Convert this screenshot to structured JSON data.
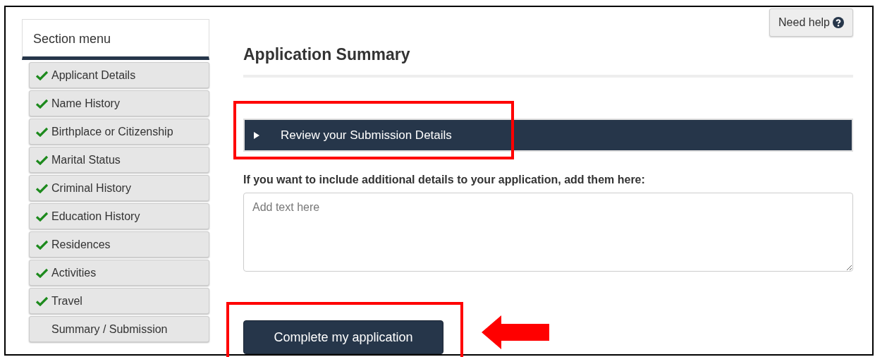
{
  "sidebar": {
    "title": "Section menu",
    "items": [
      {
        "label": "Applicant Details",
        "checked": true
      },
      {
        "label": "Name History",
        "checked": true
      },
      {
        "label": "Birthplace or Citizenship",
        "checked": true
      },
      {
        "label": "Marital Status",
        "checked": true
      },
      {
        "label": "Criminal History",
        "checked": true
      },
      {
        "label": "Education History",
        "checked": true
      },
      {
        "label": "Residences",
        "checked": true
      },
      {
        "label": "Activities",
        "checked": true
      },
      {
        "label": "Travel",
        "checked": true
      },
      {
        "label": "Summary / Submission",
        "checked": false
      }
    ]
  },
  "help_button": {
    "label": "Need help"
  },
  "page_title": "Application Summary",
  "accordion": {
    "label": "Review your Submission Details",
    "expanded": false
  },
  "details_field": {
    "label": "If you want to include additional details to your application, add them here:",
    "placeholder": "Add text here"
  },
  "submit_button": {
    "label": "Complete my application"
  }
}
